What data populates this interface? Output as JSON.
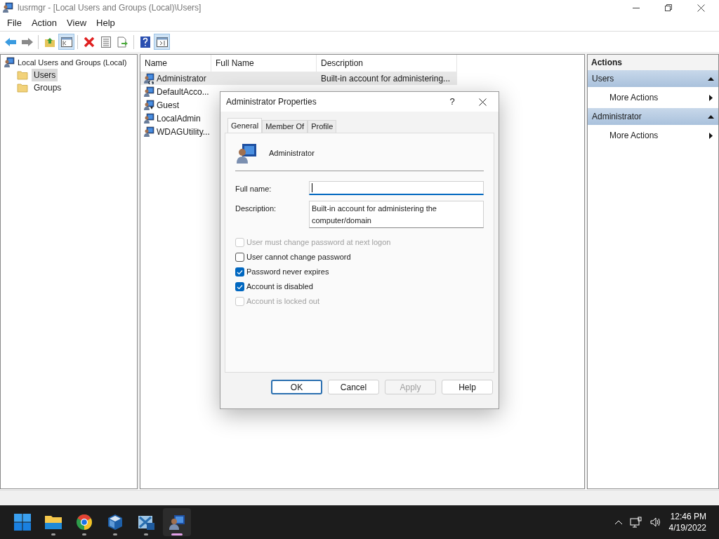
{
  "window": {
    "title": "lusrmgr - [Local Users and Groups (Local)\\Users]"
  },
  "menu": [
    "File",
    "Action",
    "View",
    "Help"
  ],
  "toolbar": [
    {
      "kind": "back",
      "pressed": false
    },
    {
      "kind": "forward",
      "pressed": false
    },
    {
      "kind": "sep"
    },
    {
      "kind": "up",
      "pressed": false
    },
    {
      "kind": "tree",
      "pressed": true
    },
    {
      "kind": "sep"
    },
    {
      "kind": "delete",
      "pressed": false
    },
    {
      "kind": "properties",
      "pressed": false
    },
    {
      "kind": "export",
      "pressed": false
    },
    {
      "kind": "sep"
    },
    {
      "kind": "help",
      "pressed": false
    },
    {
      "kind": "pane",
      "pressed": true
    }
  ],
  "tree": {
    "label": "Local Users and Groups (Local)",
    "children": [
      {
        "label": "Users",
        "selected": true
      },
      {
        "label": "Groups",
        "selected": false
      }
    ]
  },
  "list": {
    "columns": [
      "Name",
      "Full Name",
      "Description"
    ],
    "rows": [
      {
        "name": "Administrator",
        "description": "Built-in account for administering...",
        "selected": true,
        "kind": "disabled-user"
      },
      {
        "name": "DefaultAcco...",
        "selected": false,
        "kind": "user"
      },
      {
        "name": "Guest",
        "selected": false,
        "kind": "guest"
      },
      {
        "name": "LocalAdmin",
        "selected": false,
        "kind": "user"
      },
      {
        "name": "WDAGUtility...",
        "selected": false,
        "kind": "user"
      }
    ]
  },
  "actions": {
    "title": "Actions",
    "sections": [
      {
        "title": "Users",
        "items": [
          "More Actions"
        ]
      },
      {
        "title": "Administrator",
        "items": [
          "More Actions"
        ]
      }
    ]
  },
  "dialog": {
    "title": "Administrator Properties",
    "help": "?",
    "tabs": [
      {
        "label": "General",
        "selected": true
      },
      {
        "label": "Member Of",
        "selected": false
      },
      {
        "label": "Profile",
        "selected": false
      }
    ],
    "user_name": "Administrator",
    "fields": [
      {
        "label": "Full name:",
        "focused": true
      },
      {
        "label": "Description:",
        "value": "Built-in account for administering the computer/domain",
        "focused": false
      }
    ],
    "checkboxes": [
      {
        "label": "User must change password at next logon",
        "checked": false,
        "disabled": true
      },
      {
        "label": "User cannot change password",
        "checked": false,
        "disabled": false
      },
      {
        "label": "Password never expires",
        "checked": true,
        "disabled": false
      },
      {
        "label": "Account is disabled",
        "checked": true,
        "disabled": false
      },
      {
        "label": "Account is locked out",
        "checked": false,
        "disabled": true
      }
    ],
    "buttons": [
      {
        "label": "OK",
        "disabled": false,
        "default": true
      },
      {
        "label": "Cancel",
        "disabled": false,
        "default": false
      },
      {
        "label": "Apply",
        "disabled": true,
        "default": false
      },
      {
        "label": "Help",
        "disabled": false,
        "default": false
      }
    ]
  },
  "taskbar": {
    "apps": [
      {
        "kind": "start",
        "running": false,
        "active": false
      },
      {
        "kind": "folder",
        "running": true,
        "active": false
      },
      {
        "kind": "browser",
        "running": true,
        "active": false
      },
      {
        "kind": "cube",
        "running": true,
        "active": false
      },
      {
        "kind": "vm",
        "running": true,
        "active": false
      },
      {
        "kind": "users",
        "running": true,
        "active": true
      }
    ],
    "time": "12:46 PM",
    "date": "4/19/2022"
  }
}
